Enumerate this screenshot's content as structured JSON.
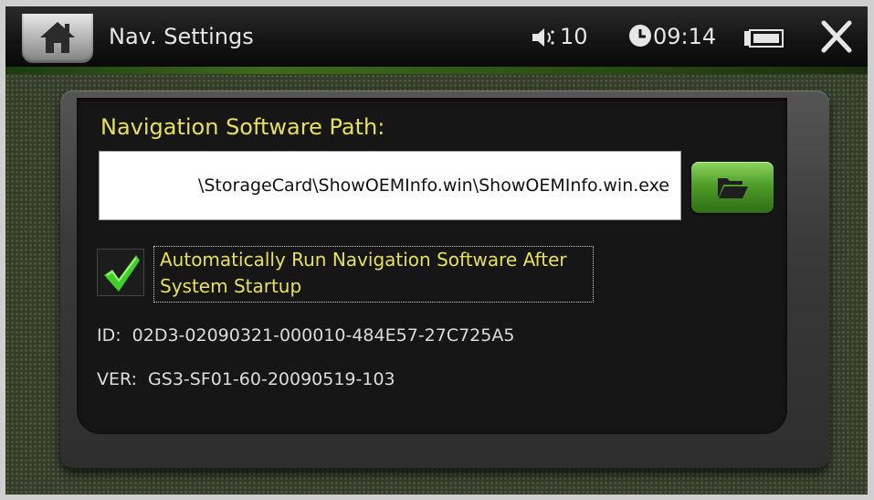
{
  "header": {
    "title": "Nav. Settings",
    "volume": "10",
    "time": "09:14"
  },
  "icons": {
    "home": "home-icon",
    "volume": "speaker-icon",
    "clock": "clock-icon",
    "battery": "battery-icon",
    "close": "close-icon",
    "browse": "folder-open-icon",
    "check": "checkmark-icon"
  },
  "settings": {
    "path_label": "Navigation Software Path:",
    "path_value": "\\StorageCard\\ShowOEMInfo.win\\ShowOEMInfo.win.exe",
    "autorun_checked": true,
    "autorun_label": "Automatically Run Navigation Software After System Startup",
    "id_label": "ID:",
    "id_value": "02D3-02090321-000010-484E57-27C725A5",
    "ver_label": "VER:",
    "ver_value": "GS3-SF01-60-20090519-103"
  },
  "colors": {
    "accent_text": "#e7e15a",
    "button_green": "#4f9e29",
    "check_green": "#3fcf2a"
  }
}
